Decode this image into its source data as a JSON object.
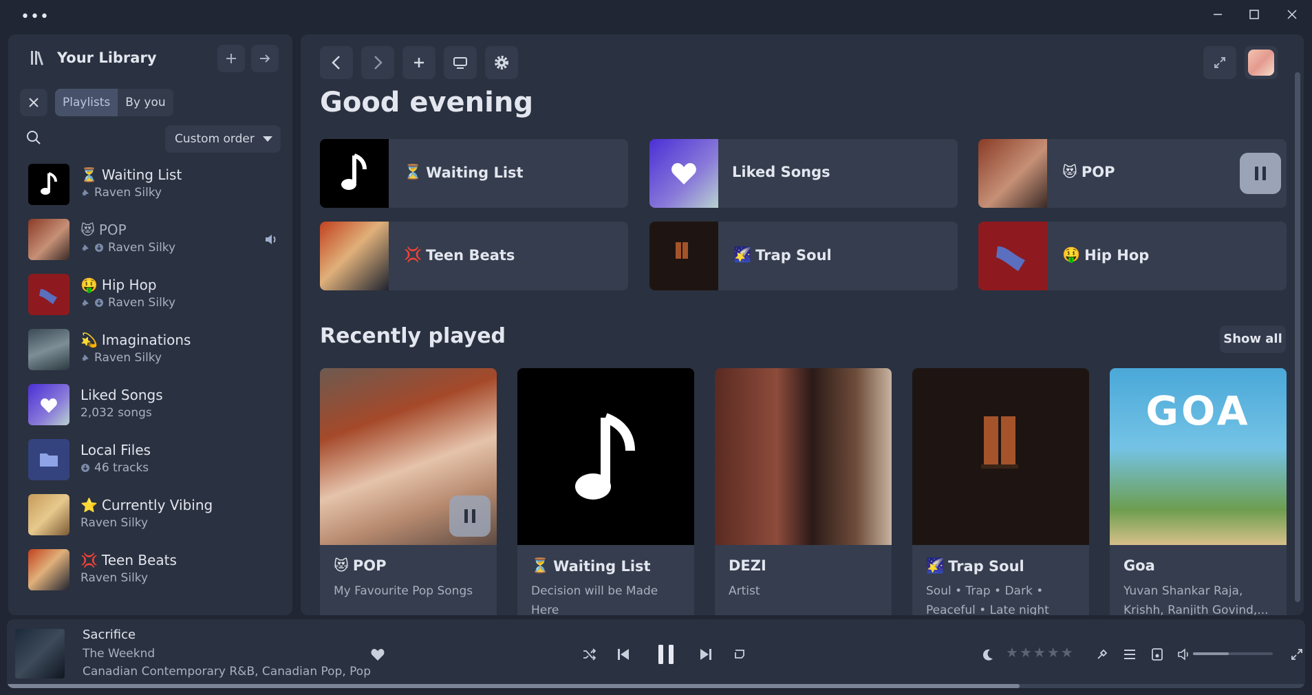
{
  "window": {
    "menu_icon": "ellipsis-icon",
    "controls": [
      "minimize-icon",
      "maximize-icon",
      "close-icon"
    ]
  },
  "sidebar": {
    "title": "Your Library",
    "filters": {
      "primary": "Playlists",
      "secondary": "By you"
    },
    "sort_label": "Custom order",
    "items": [
      {
        "emoji": "⏳",
        "name": "Waiting List",
        "sub": "Raven Silky",
        "pinned": true,
        "downloaded": false
      },
      {
        "emoji": "😻",
        "name": "POP",
        "sub": "Raven Silky",
        "pinned": true,
        "downloaded": true,
        "playing": true
      },
      {
        "emoji": "🤑",
        "name": "Hip Hop",
        "sub": "Raven Silky",
        "pinned": true,
        "downloaded": true
      },
      {
        "emoji": "💫",
        "name": "Imaginations",
        "sub": "Raven Silky",
        "pinned": true,
        "downloaded": false
      },
      {
        "emoji": "",
        "name": "Liked Songs",
        "sub": "2,032 songs",
        "pinned": false,
        "downloaded": false
      },
      {
        "emoji": "",
        "name": "Local Files",
        "sub": "46 tracks",
        "pinned": false,
        "downloaded": true
      },
      {
        "emoji": "⭐",
        "name": "Currently Vibing",
        "sub": "Raven Silky",
        "pinned": false,
        "downloaded": false
      },
      {
        "emoji": "💢",
        "name": "Teen Beats",
        "sub": "Raven Silky",
        "pinned": false,
        "downloaded": false
      }
    ]
  },
  "main": {
    "greeting": "Good evening",
    "quick_picks": [
      {
        "emoji": "⏳",
        "label": "Waiting List"
      },
      {
        "emoji": "",
        "label": "Liked Songs"
      },
      {
        "emoji": "😻",
        "label": "POP"
      },
      {
        "emoji": "💢",
        "label": "Teen Beats"
      },
      {
        "emoji": "🌠",
        "label": "Trap Soul"
      },
      {
        "emoji": "🤑",
        "label": "Hip Hop"
      }
    ],
    "recent_title": "Recently played",
    "show_all": "Show all",
    "recent": [
      {
        "emoji": "😻",
        "title": "POP",
        "desc": "My Favourite Pop Songs"
      },
      {
        "emoji": "⏳",
        "title": "Waiting List",
        "desc": "Decision will be Made Here"
      },
      {
        "emoji": "",
        "title": "DEZI",
        "desc": "Artist"
      },
      {
        "emoji": "🌠",
        "title": "Trap Soul",
        "desc": "Soul • Trap • Dark • Peaceful • Late night"
      },
      {
        "emoji": "",
        "title": "Goa",
        "desc": "Yuvan Shankar Raja, Krishh, Ranjith Govind,..."
      }
    ],
    "goa_art_text": "GOA"
  },
  "player": {
    "title": "Sacrifice",
    "artist": "The Weeknd",
    "genres": "Canadian Contemporary R&B, Canadian Pop, Pop",
    "rating": 0,
    "rating_max": 5,
    "progress_fraction": 0.78,
    "volume_fraction": 0.45,
    "colors": {
      "accent": "#e6e9f0",
      "background": "#202633",
      "panel": "#2a3140"
    }
  }
}
